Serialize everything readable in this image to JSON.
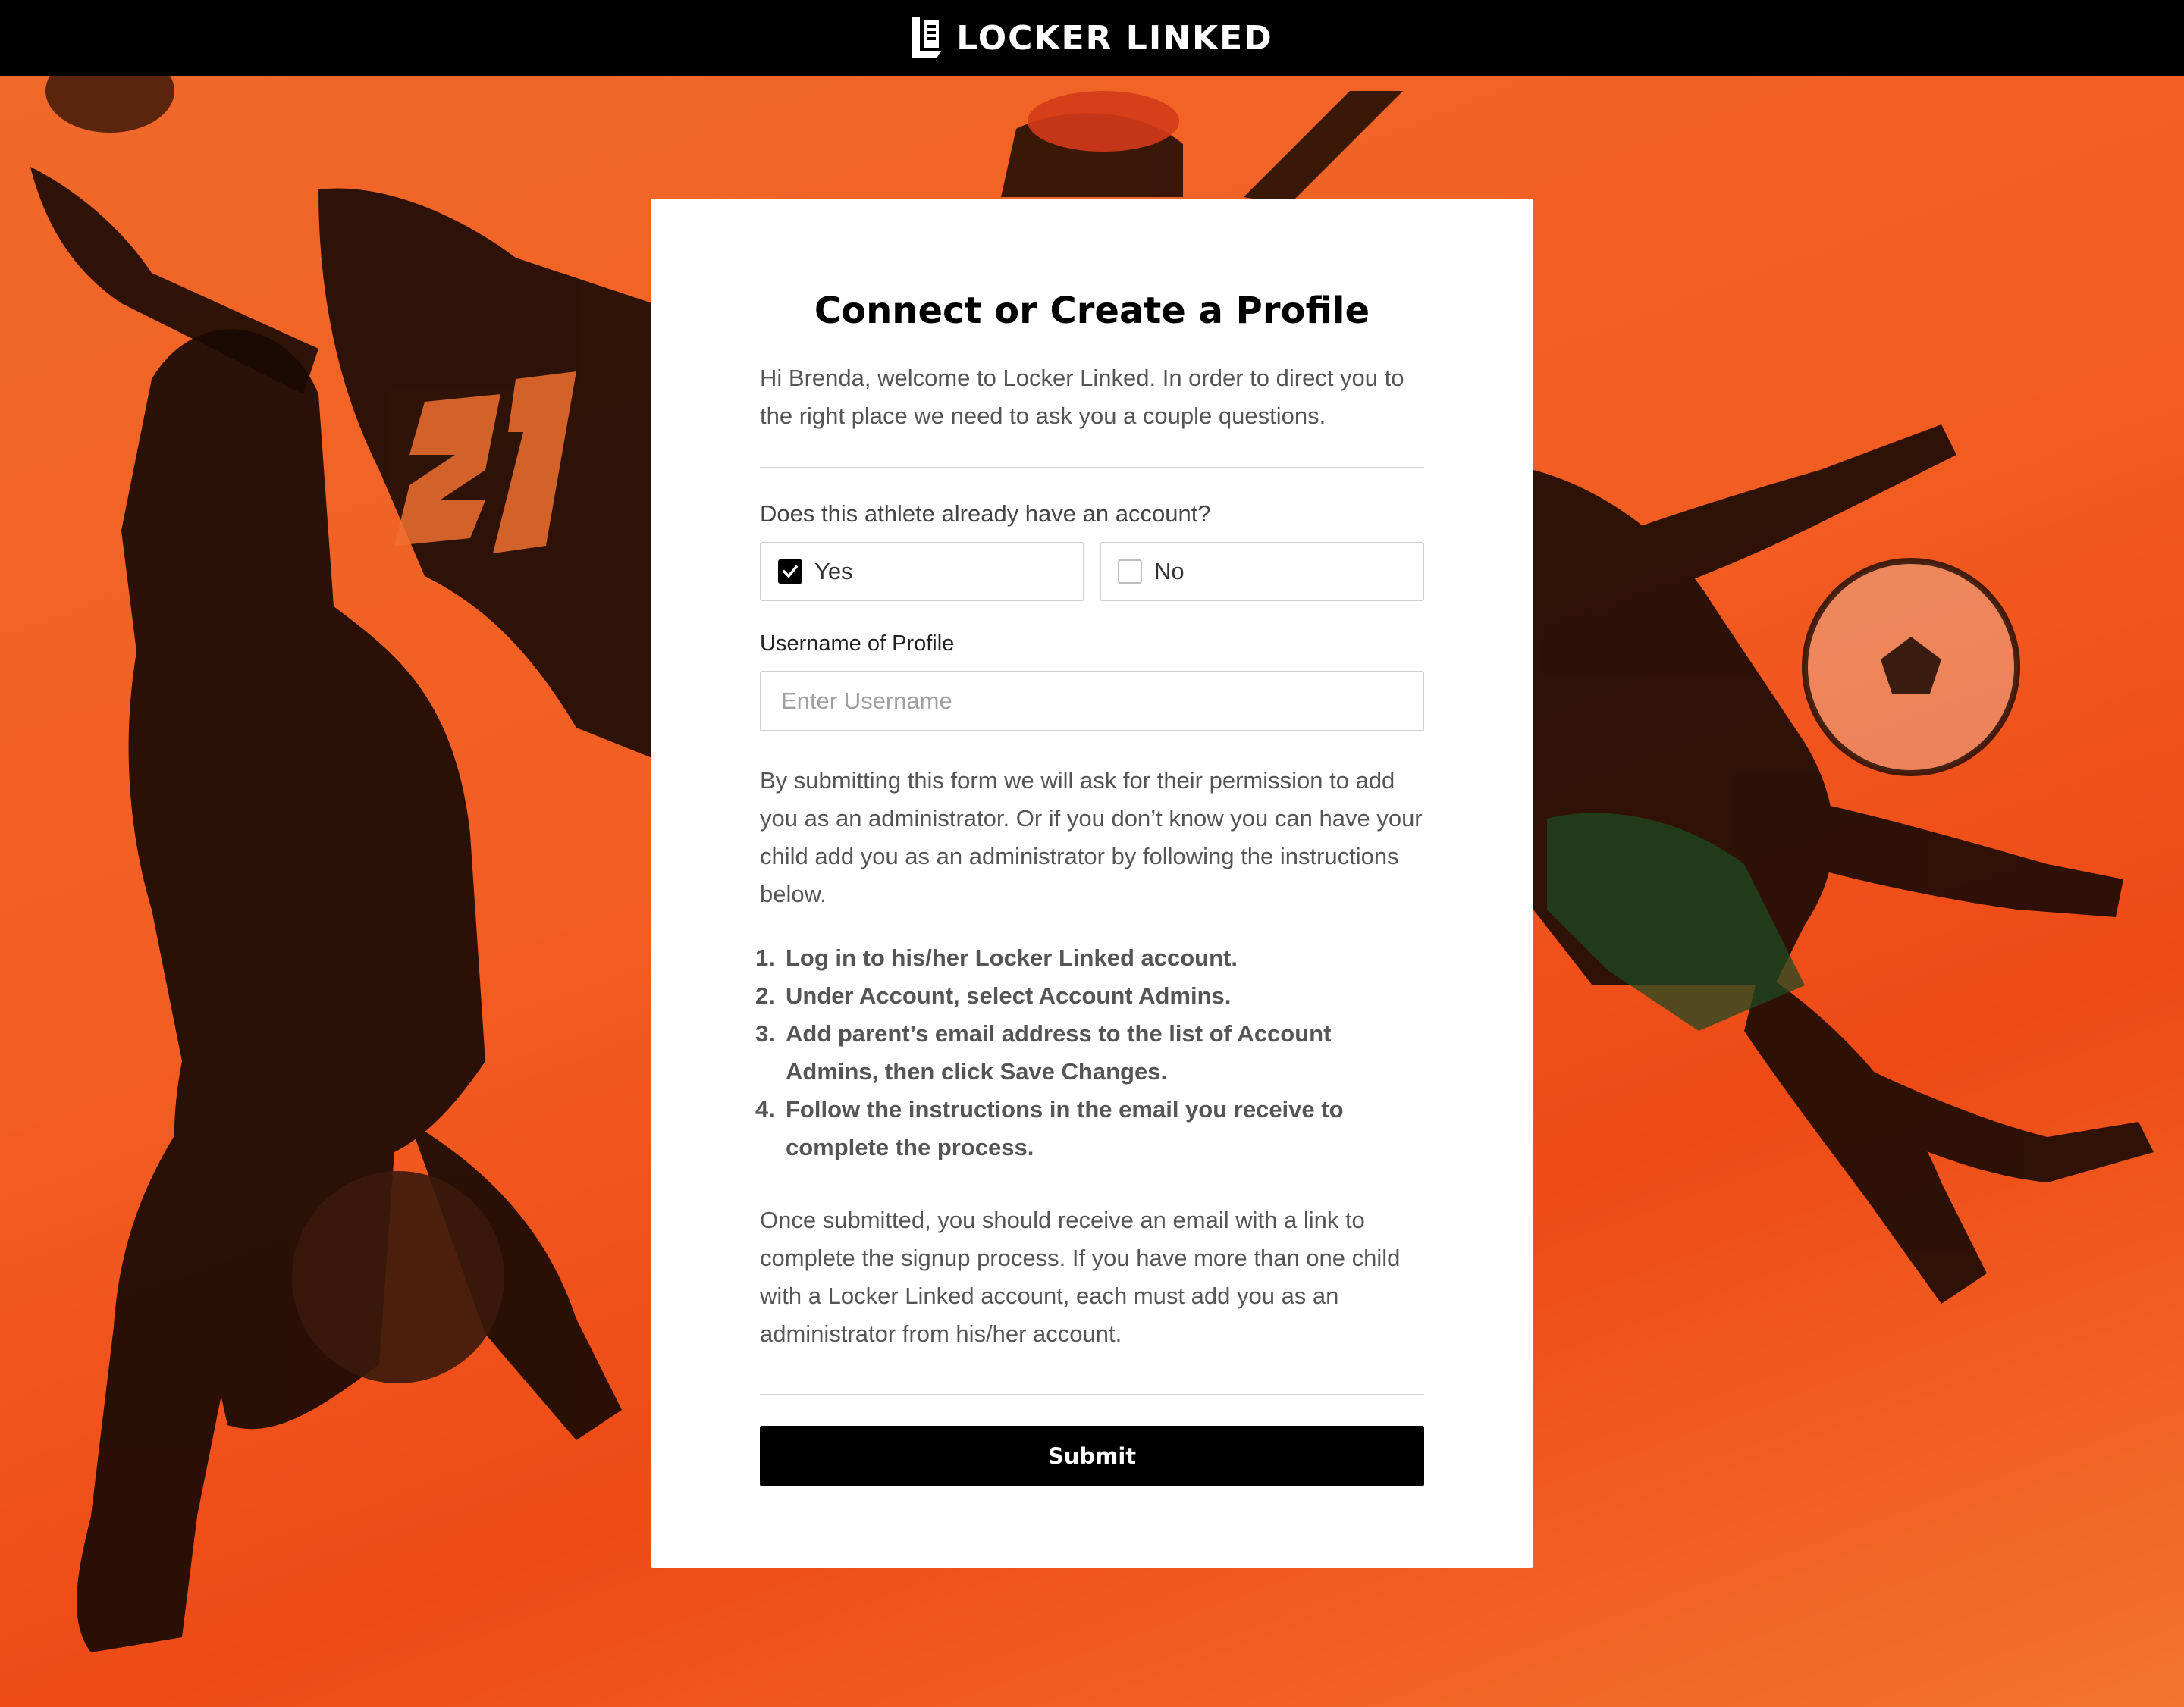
{
  "brand": {
    "name": "LOCKER LINKED"
  },
  "form": {
    "title": "Connect or Create a Profile",
    "intro": "Hi Brenda, welcome to Locker Linked. In order to direct you to the right place we need to ask you a couple questions.",
    "question": "Does this athlete already have an account?",
    "options": [
      {
        "label": "Yes",
        "checked": true
      },
      {
        "label": "No",
        "checked": false
      }
    ],
    "username_label": "Username of Profile",
    "username_placeholder": "Enter Username",
    "username_value": "",
    "permission_text": "By submitting this form we will ask for their permission to add you as an administrator. Or if you don’t know you can have your child add you as an administrator by following the instructions below.",
    "steps": [
      {
        "num": "1.",
        "text": "Log in to his/her Locker Linked account."
      },
      {
        "num": "2.",
        "text": "Under Account, select Account Admins."
      },
      {
        "num": "3.",
        "text": "Add parent’s email address to the list of Account Admins, then click Save Changes."
      },
      {
        "num": "4.",
        "text": "Follow the instructions in the email you receive to complete the process."
      }
    ],
    "after_text": "Once submitted, you should receive an email with a link to complete the signup process. If you have more than one child with a Locker Linked account, each must add you as an administrator from his/her account.",
    "submit_label": "Submit"
  },
  "colors": {
    "background_orange": "#f25d22",
    "topbar": "#000000",
    "card": "#ffffff",
    "button": "#000000"
  },
  "icons": {
    "logo": "locker-logo-icon",
    "checked": "check-icon"
  }
}
